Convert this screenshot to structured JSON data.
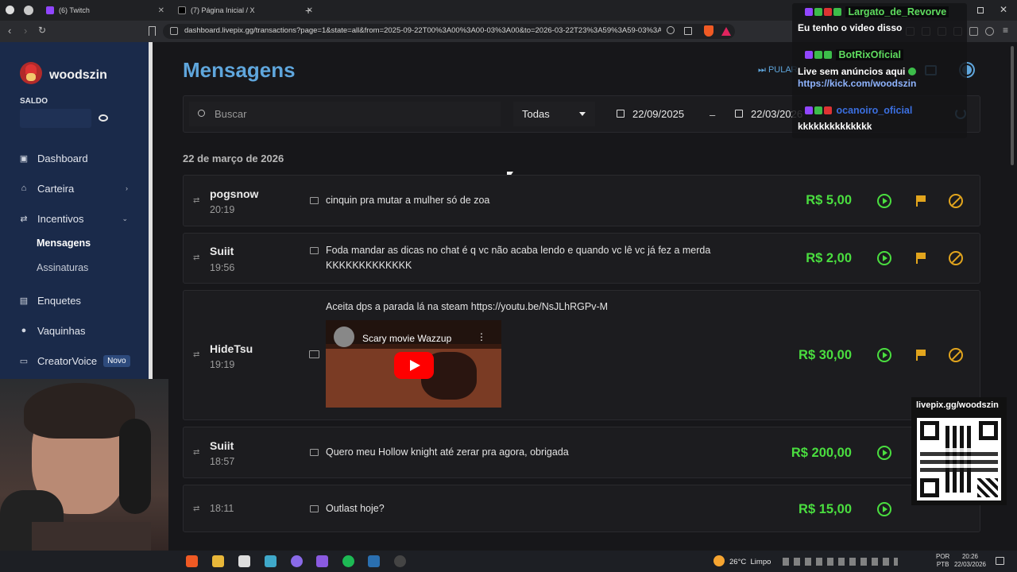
{
  "browser": {
    "tabs": [
      {
        "label": "(6) Twitch"
      },
      {
        "label": "(7) Página Inicial / X"
      }
    ],
    "url": "dashboard.livepix.gg/transactions?page=1&state=all&from=2025-09-22T00%3A00%3A00-03%3A00&to=2026-03-22T23%3A59%3A59-03%3A..."
  },
  "sidebar": {
    "username": "woodszin",
    "balance_label": "SALDO",
    "items": [
      {
        "label": "Dashboard",
        "icon": "dashboard-icon"
      },
      {
        "label": "Carteira",
        "icon": "wallet-icon"
      },
      {
        "label": "Incentivos",
        "icon": "incentives-icon"
      }
    ],
    "subitems": [
      {
        "label": "Mensagens"
      },
      {
        "label": "Assinaturas"
      }
    ],
    "items2": [
      {
        "label": "Enquetes",
        "icon": "poll-icon"
      },
      {
        "label": "Vaquinhas",
        "icon": "piggy-icon"
      },
      {
        "label": "CreatorVoice",
        "icon": "voice-icon",
        "badge": "Novo"
      }
    ]
  },
  "main": {
    "title": "Mensagens",
    "skip_label": "PULAR",
    "search_placeholder": "Buscar",
    "filter_value": "Todas",
    "date_from": "22/09/2025",
    "date_sep": "–",
    "date_to": "22/03/2026",
    "date_heading": "22 de março de 2026",
    "messages": [
      {
        "user": "pogsnow",
        "time": "20:19",
        "text": "cinquin pra mutar a mulher só de zoa",
        "amount": "R$ 5,00"
      },
      {
        "user": "Suiit",
        "time": "19:56",
        "text": "Foda mandar as dicas no chat é q vc não acaba lendo e quando vc lê vc já fez a merda",
        "text2": "KKKKKKKKKKKKK",
        "amount": "R$ 2,00"
      },
      {
        "user": "HideTsu",
        "time": "19:19",
        "text": "Aceita dps a parada lá na steam https://youtu.be/NsJLhRGPv-M",
        "video_title": "Scary movie Wazzup",
        "amount": "R$ 30,00"
      },
      {
        "user": "Suiit",
        "time": "18:57",
        "text": "Quero meu Hollow knight até zerar pra agora, obrigada",
        "amount": "R$ 200,00"
      },
      {
        "user": "",
        "time": "18:11",
        "text": "Outlast hoje?",
        "amount": "R$ 15,00"
      }
    ]
  },
  "overlay": {
    "chat": [
      {
        "user": "Largato_de_Revorve",
        "text": "Eu tenho o video disso"
      },
      {
        "user": "BotRixOficial",
        "text": "Live sem anúncios aqui",
        "link": "https://kick.com/woodszin"
      },
      {
        "user": "ocanoiro_oficial",
        "text": "kkkkkkkkkkkkkk"
      }
    ],
    "qr_label": "livepix.gg/woodszin"
  },
  "taskbar": {
    "weather": "26°C  Limpo",
    "lang1": "POR",
    "lang2": "PTB",
    "time": "20:26",
    "date": "22/03/2026"
  },
  "colors": {
    "accent": "#4ade3f",
    "warning": "#e2a51d",
    "title": "#5fa6dc",
    "sidebar": "#1a2a4a"
  }
}
